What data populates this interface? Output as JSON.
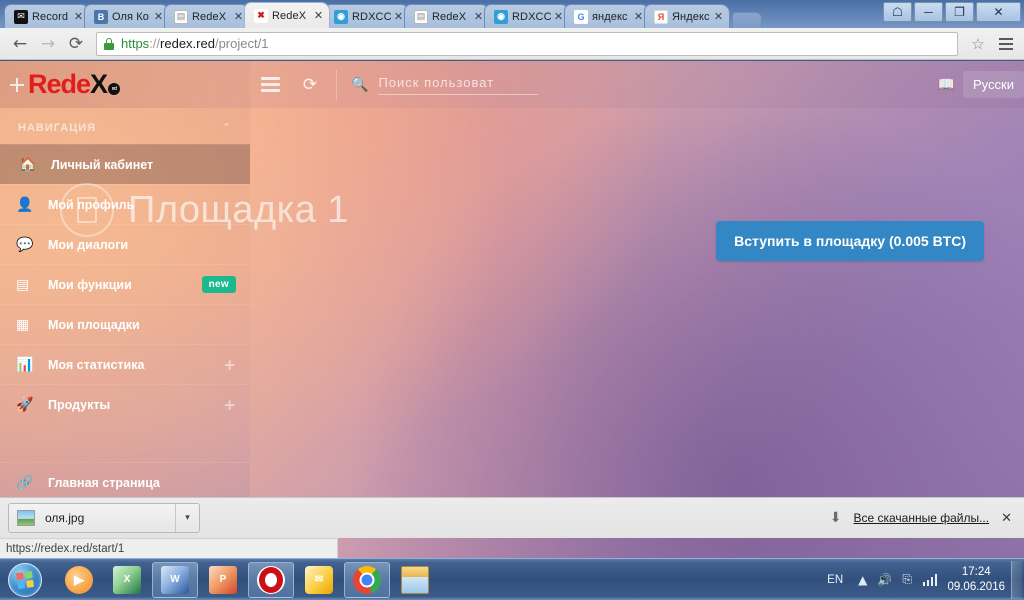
{
  "browser": {
    "tabs": [
      {
        "title": "Record",
        "favicon": "envelope-icon",
        "active": false
      },
      {
        "title": "Оля Ко",
        "favicon": "vk-icon",
        "active": false
      },
      {
        "title": "RedeX",
        "favicon": "page-icon",
        "active": false
      },
      {
        "title": "RedeX",
        "favicon": "redex-icon",
        "active": true
      },
      {
        "title": "RDXCC",
        "favicon": "rdxcc-icon",
        "active": false
      },
      {
        "title": "RedeX",
        "favicon": "page-icon",
        "active": false
      },
      {
        "title": "RDXCC",
        "favicon": "rdxcc-icon",
        "active": false
      },
      {
        "title": "яндекс",
        "favicon": "google-icon",
        "active": false
      },
      {
        "title": "Яндекс",
        "favicon": "yandex-icon",
        "active": false
      }
    ],
    "tab_close_label": "✕",
    "window_controls": {
      "user": "☖",
      "minimize": "─",
      "maximize": "❐",
      "close": "✕"
    },
    "nav": {
      "back": "←",
      "forward": "→",
      "reload": "⟳"
    },
    "url": {
      "scheme": "https",
      "sep": "://",
      "host": "redex.red",
      "path": "/project/1"
    },
    "bookmark_star": "☆",
    "status_url": "https://redex.red/start/1"
  },
  "app": {
    "logo": {
      "rede": "Rede",
      "x": "X",
      "dot": "red"
    },
    "menu_toggle": "hamburger-icon",
    "refresh_icon": "⟳",
    "search": {
      "icon": "🔍",
      "placeholder": "Поиск пользоват",
      "value": ""
    },
    "language": {
      "icon": "📖",
      "label": "Русски"
    }
  },
  "sidebar": {
    "heading": "НАВИГАЦИЯ",
    "collapse_chevron": "⌃",
    "items": [
      {
        "label": "Личный кабинет",
        "icon": "home-icon",
        "glyph": "⌂",
        "active": true
      },
      {
        "label": "Мой профиль",
        "icon": "user-icon",
        "glyph": "👤",
        "active": false
      },
      {
        "label": "Мои диалоги",
        "icon": "chat-icon",
        "glyph": "💬",
        "active": false
      },
      {
        "label": "Мои функции",
        "icon": "list-icon",
        "glyph": "▤",
        "active": false,
        "badge": "new"
      },
      {
        "label": "Мои площадки",
        "icon": "grid-icon",
        "glyph": "▦",
        "active": false
      },
      {
        "label": "Моя статистика",
        "icon": "chart-icon",
        "glyph": "📊",
        "active": false,
        "expander": "+"
      },
      {
        "label": "Продукты",
        "icon": "rocket-icon",
        "glyph": "🚀",
        "active": false,
        "expander": "+"
      },
      {
        "label": "Главная страница",
        "icon": "link-icon",
        "glyph": "🔗",
        "active": false
      }
    ]
  },
  "main": {
    "page_title": "Площадка 1",
    "page_title_icon": "document-circle-icon",
    "join_button": "Вступить в площадку (0.005 BTC)"
  },
  "download_shelf": {
    "file_name": "оля.jpg",
    "file_icon": "image-thumbnail-icon",
    "caret": "▾",
    "download_arrow": "⬇",
    "show_all_label": "Все скачанные файлы...",
    "close_label": "✕"
  },
  "taskbar": {
    "start": "windows-start-orb",
    "apps": [
      {
        "name": "windows-media-player",
        "glyph": "▶"
      },
      {
        "name": "microsoft-excel",
        "glyph": "X"
      },
      {
        "name": "microsoft-word",
        "glyph": "W"
      },
      {
        "name": "microsoft-powerpoint",
        "glyph": "P"
      },
      {
        "name": "opera-browser",
        "glyph": ""
      },
      {
        "name": "microsoft-outlook",
        "glyph": "✉"
      },
      {
        "name": "google-chrome",
        "glyph": ""
      },
      {
        "name": "windows-explorer",
        "glyph": ""
      }
    ],
    "tray": {
      "language": "EN",
      "show_hidden": "▲",
      "volume": "🔊",
      "usb": "⎘",
      "network": "signal-bars-icon",
      "time": "17:24",
      "date": "09.06.2016"
    }
  },
  "colors": {
    "accent_blue": "#3387c4",
    "logo_red": "#e21d1d",
    "badge_green": "#1db98d",
    "url_green": "#2a8a3e"
  }
}
